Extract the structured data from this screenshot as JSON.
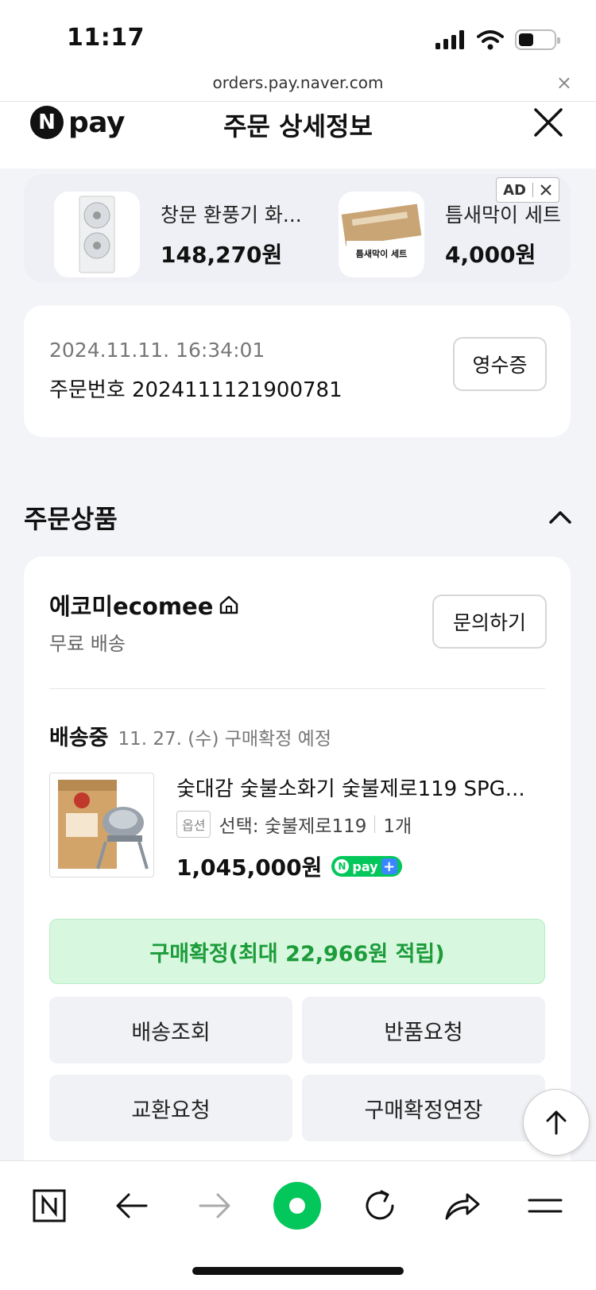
{
  "status_bar": {
    "time": "11:17"
  },
  "browser": {
    "url": "orders.pay.naver.com",
    "close_glyph": "×"
  },
  "header": {
    "logo_mark": "N",
    "logo_word": "pay",
    "title": "주문 상세정보"
  },
  "ads": {
    "badge": "AD",
    "items": [
      {
        "name": "창문 환풍기 화...",
        "price": "148,270원",
        "icon": "window-fan-product"
      },
      {
        "name": "틈새막이 세트",
        "price": "4,000원",
        "icon": "gap-blocker-set-product",
        "thumb_title": "틈새막이 세트"
      }
    ]
  },
  "order": {
    "datetime": "2024.11.11. 16:34:01",
    "number_label": "주문번호 2024111121900781",
    "receipt_button": "영수증"
  },
  "section": {
    "title": "주문상품"
  },
  "store": {
    "name": "에코미ecomee",
    "shipping": "무료 배송",
    "inquiry_button": "문의하기"
  },
  "shipment": {
    "status": "배송중",
    "eta": "11. 27. (수) 구매확정 예정"
  },
  "product": {
    "name": "숯대감 숯불소화기 숯불제로119 SPG...",
    "option_tag": "옵션",
    "option": "선택: 숯불제로119",
    "quantity": "1개",
    "price": "1,045,000원",
    "npay_plus_label": "pay"
  },
  "actions": {
    "confirm": "구매확정(최대 22,966원 적립)",
    "track": "배송조회",
    "return": "반품요청",
    "exchange": "교환요청",
    "extend": "구매확정연장"
  },
  "colors": {
    "naver_green": "#03c75a",
    "confirm_bg": "#d8f7df",
    "confirm_text": "#1c9c3a",
    "page_bg": "#f3f4f8"
  }
}
